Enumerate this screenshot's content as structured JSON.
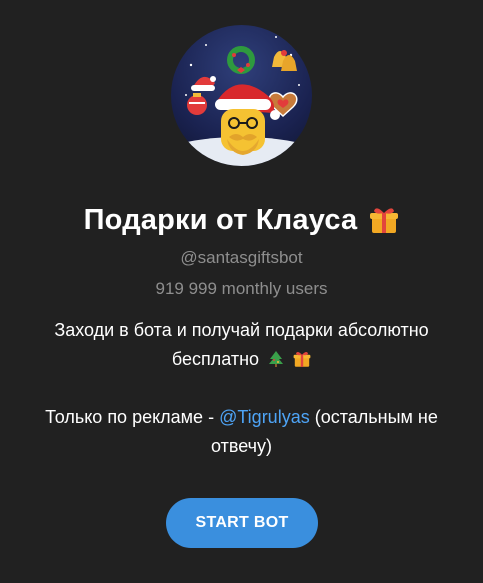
{
  "profile": {
    "name": "Подарки от Клауса",
    "username": "@santasgiftsbot",
    "monthly_users": "919 999 monthly users",
    "avatar_icon": "santa-gifts-avatar",
    "title_emoji_icon": "gift-icon"
  },
  "description": {
    "line1": "Заходи в бота и получай подарки абсолютно",
    "line2": "бесплатно",
    "line2_emojis": [
      "christmas-tree-icon",
      "gift-icon"
    ],
    "line3_prefix": "Только по рекламе - ",
    "line3_mention": "@Tigrulyas",
    "line3_suffix": " (остальным не",
    "line4": "отвечу)"
  },
  "actions": {
    "start_label": "START BOT"
  },
  "colors": {
    "background": "#212121",
    "muted_text": "#8e8e8e",
    "link": "#4ea4f6",
    "button": "#3a8fde"
  }
}
